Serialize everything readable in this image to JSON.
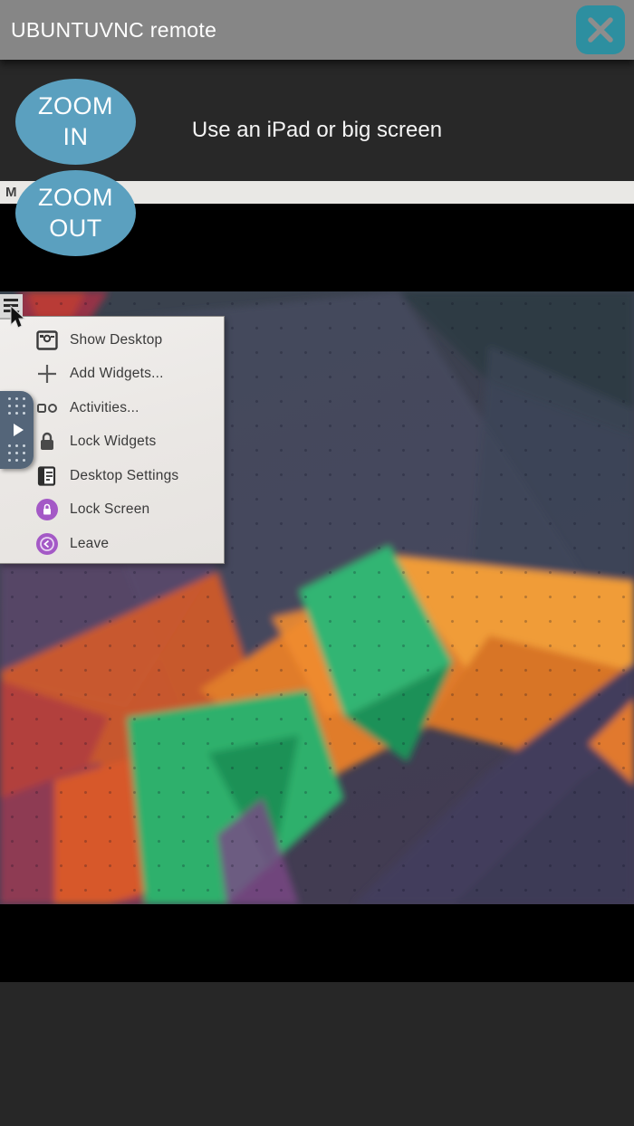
{
  "titlebar": {
    "title": "UBUNTUVNC remote",
    "bg_color": "#868686",
    "close_button_color": "#2d8fa0"
  },
  "controls": {
    "zoom_in_label": "ZOOM\nIN",
    "zoom_out_label": "ZOOM\nOUT",
    "button_color": "#5ba0bf",
    "hint_text": "Use an iPad or big screen"
  },
  "menu_strip": {
    "label": "M"
  },
  "remote_desktop": {
    "context_menu": {
      "items": [
        {
          "label": "Show Desktop",
          "icon": "show-desktop-icon"
        },
        {
          "label": "Add Widgets...",
          "icon": "add-widgets-icon"
        },
        {
          "label": "Activities...",
          "icon": "activities-icon"
        },
        {
          "label": "Lock Widgets",
          "icon": "lock-widgets-icon"
        },
        {
          "label": "Desktop Settings",
          "icon": "desktop-settings-icon"
        },
        {
          "label": "Lock Screen",
          "icon": "lock-screen-icon"
        },
        {
          "label": "Leave",
          "icon": "leave-icon"
        }
      ],
      "accent_purple": "#a459c6"
    },
    "wallpaper_colors": {
      "slate": "#3b4450",
      "orange": "#e07b2a",
      "green": "#2fb06c",
      "purple_dark": "#433e5b",
      "red": "#b2403c"
    }
  }
}
